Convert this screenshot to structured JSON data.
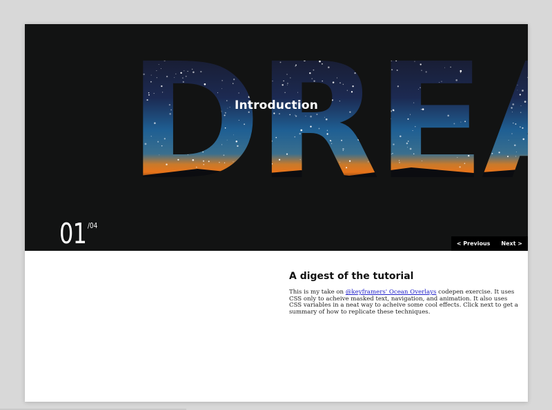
{
  "hero": {
    "background_word": "DREA",
    "title": "Introduction"
  },
  "counter": {
    "current": "01",
    "total": "/04"
  },
  "nav": {
    "previous_label": "< Previous",
    "next_label": "Next >"
  },
  "content": {
    "heading": "A digest of the tutorial",
    "text_before_link": "This is my take on ",
    "link_text": "@keyframers' Ocean Overlays",
    "text_after_link": " codepen exercise. It uses CSS only to acheive masked text, navigation, and animation. It also uses CSS variables in a neat way to acheive some cool effects. Click next to get a summary of how to replicate these techniques."
  },
  "colors": {
    "page_bg": "#d8d8d8",
    "card_bg": "#ffffff",
    "hero_bg": "#121313",
    "nav_bg": "#000000",
    "link": "#2020c8"
  }
}
